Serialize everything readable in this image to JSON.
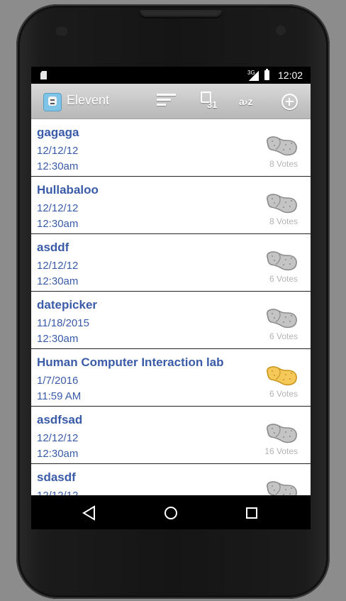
{
  "status_bar": {
    "network": "3G",
    "time": "12:02"
  },
  "action_bar": {
    "app_title": "Elevent",
    "calendar_day": "31",
    "az_label": "a›z",
    "actions": [
      "sort-icon",
      "calendar-icon",
      "az-sort-icon",
      "add-icon"
    ]
  },
  "events": [
    {
      "name": "gagaga",
      "date": "12/12/12",
      "time": "12:30am",
      "votes": "8 Votes",
      "voted": false
    },
    {
      "name": "Hullabaloo",
      "date": "12/12/12",
      "time": "12:30am",
      "votes": "8 Votes",
      "voted": false
    },
    {
      "name": "asddf",
      "date": "12/12/12",
      "time": "12:30am",
      "votes": "6 Votes",
      "voted": false
    },
    {
      "name": "datepicker",
      "date": "11/18/2015",
      "time": "12:30am",
      "votes": "6 Votes",
      "voted": false
    },
    {
      "name": "Human Computer Interaction lab",
      "date": "1/7/2016",
      "time": "11:59 AM",
      "votes": "6 Votes",
      "voted": true
    },
    {
      "name": "asdfsad",
      "date": "12/12/12",
      "time": "12:30am",
      "votes": "16 Votes",
      "voted": false
    },
    {
      "name": "sdasdf",
      "date": "12/12/12",
      "time": "",
      "votes": "",
      "voted": false
    }
  ],
  "colors": {
    "event_text": "#3a5ba8",
    "potato_default": "#c4c4c4",
    "potato_voted": "#f5c85a"
  },
  "nav": [
    "back-icon",
    "home-icon",
    "recents-icon"
  ]
}
